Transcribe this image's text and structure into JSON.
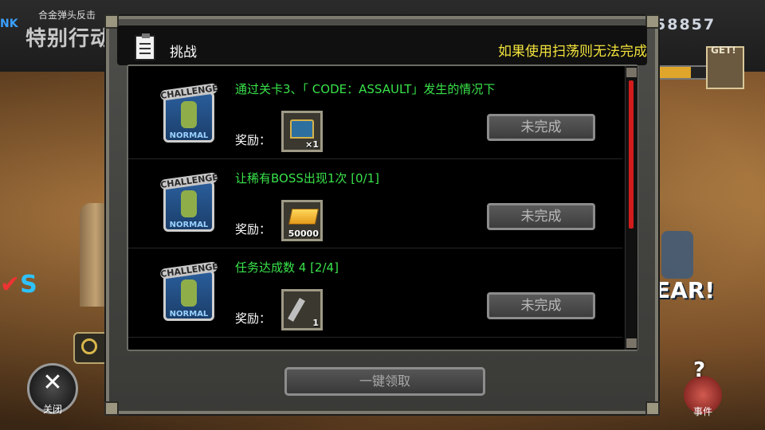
{
  "background": {
    "brand_fragment": "NK",
    "subtitle": "合金弹头反击",
    "title_fragment": "特别行动",
    "score_fragment": "58857",
    "get_label": "GET!",
    "clear_fragment": "EAR!",
    "rs_fragment": "S"
  },
  "close_button": {
    "symbol": "✕",
    "label": "关闭"
  },
  "event_button": {
    "symbol": "?",
    "label": "事件"
  },
  "dialog": {
    "title": "挑战",
    "warning": "如果使用扫荡则无法完成",
    "reward_label": "奖励：",
    "badge_top": "CHALLENGE",
    "badge_bottom": "NORMAL",
    "challenges": [
      {
        "description": "通过关卡3、「 CODE：ASSAULT」发生的情况下",
        "reward_icon": "treasure-chest-icon",
        "reward_qty": "×1",
        "status": "未完成"
      },
      {
        "description": "让稀有BOSS出现1次 [0/1]",
        "reward_icon": "gold-bar-icon",
        "reward_qty": "50000",
        "status": "未完成"
      },
      {
        "description": "任务达成数 4 [2/4]",
        "reward_icon": "wrench-icon",
        "reward_qty": "1",
        "status": "未完成"
      }
    ],
    "claim_all_label": "一键领取"
  },
  "colors": {
    "description_green": "#39e24a",
    "warning_yellow": "#f2e33c",
    "scroll_thumb": "#d21c1c"
  }
}
